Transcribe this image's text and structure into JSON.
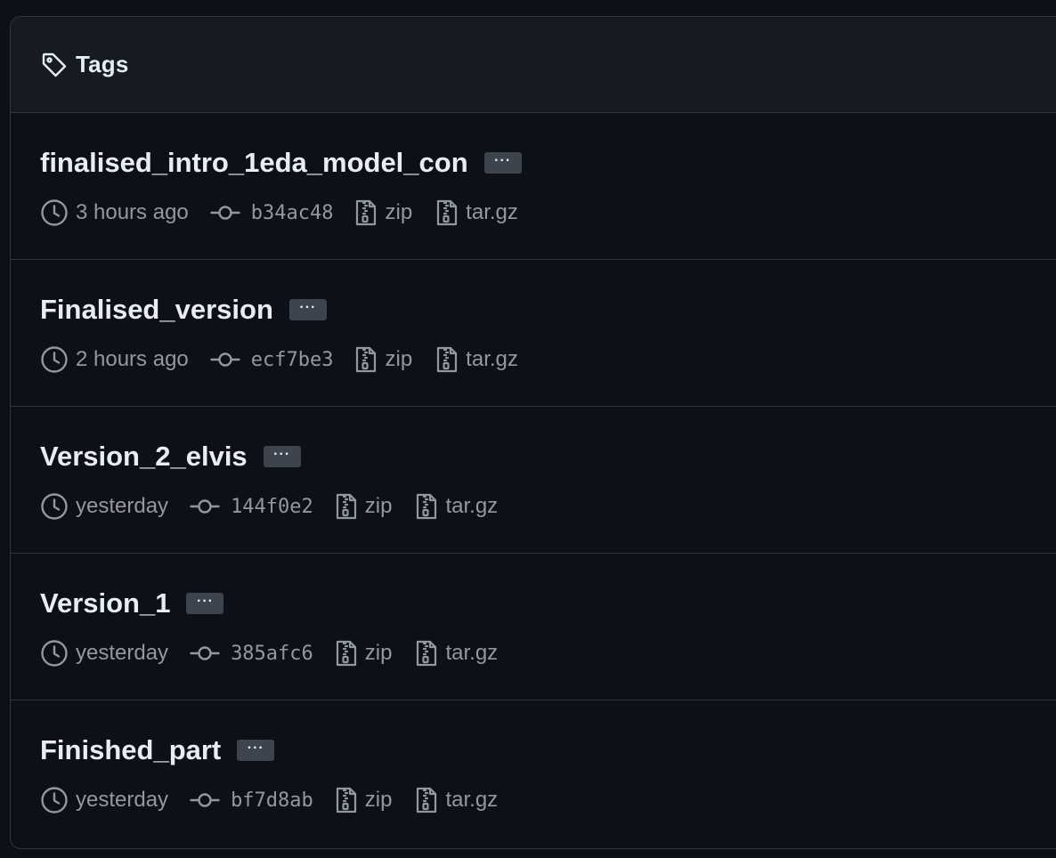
{
  "header": {
    "title": "Tags",
    "icon": "tag-icon"
  },
  "tags": [
    {
      "name": "finalised_intro_1eda_model_con",
      "time": "3 hours ago",
      "commit": "b34ac48",
      "zip": "zip",
      "tar": "tar.gz"
    },
    {
      "name": "Finalised_version",
      "time": "2 hours ago",
      "commit": "ecf7be3",
      "zip": "zip",
      "tar": "tar.gz"
    },
    {
      "name": "Version_2_elvis",
      "time": "yesterday",
      "commit": "144f0e2",
      "zip": "zip",
      "tar": "tar.gz"
    },
    {
      "name": "Version_1",
      "time": "yesterday",
      "commit": "385afc6",
      "zip": "zip",
      "tar": "tar.gz"
    },
    {
      "name": "Finished_part",
      "time": "yesterday",
      "commit": "bf7d8ab",
      "zip": "zip",
      "tar": "tar.gz"
    }
  ],
  "more_label": "···",
  "colors": {
    "background": "#0d1117",
    "header_background": "#161b22",
    "border": "#30363d",
    "text_primary": "#e6edf3",
    "text_muted": "#9198a1",
    "more_button": "#3d444d"
  }
}
